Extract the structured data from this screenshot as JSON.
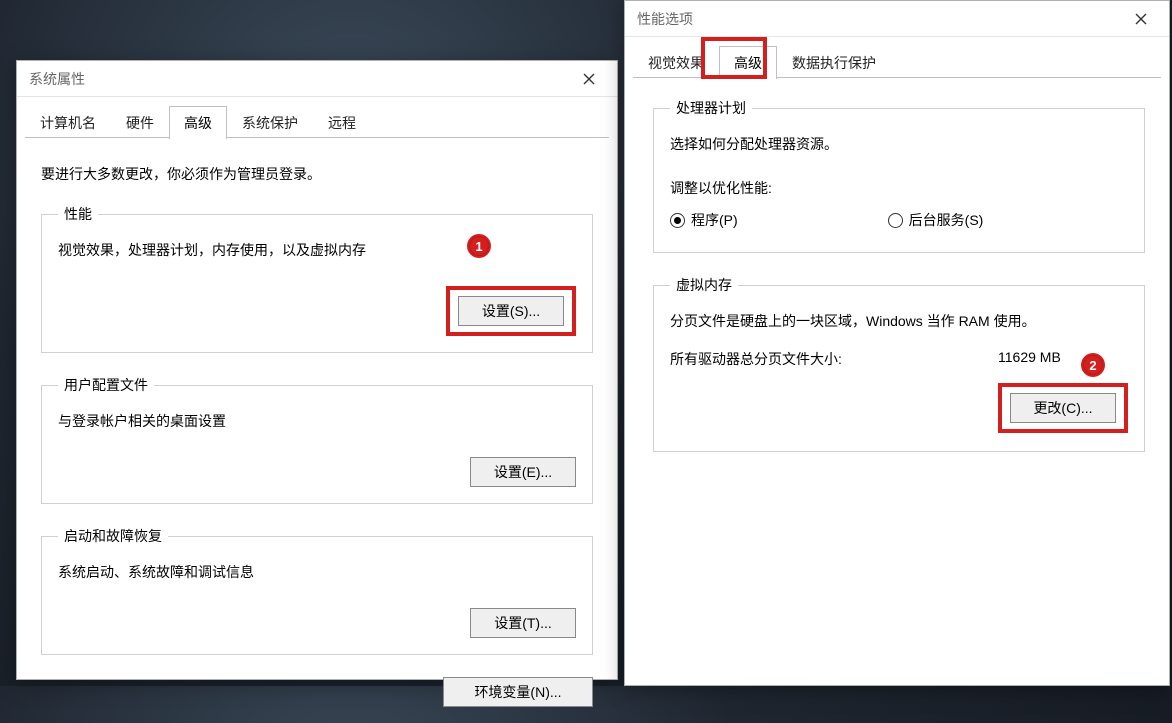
{
  "left": {
    "title": "系统属性",
    "tabs": [
      "计算机名",
      "硬件",
      "高级",
      "系统保护",
      "远程"
    ],
    "active_tab_index": 2,
    "instruction": "要进行大多数更改，你必须作为管理员登录。",
    "perf": {
      "legend": "性能",
      "desc": "视觉效果，处理器计划，内存使用，以及虚拟内存",
      "button": "设置(S)..."
    },
    "profiles": {
      "legend": "用户配置文件",
      "desc": "与登录帐户相关的桌面设置",
      "button": "设置(E)..."
    },
    "startup": {
      "legend": "启动和故障恢复",
      "desc": "系统启动、系统故障和调试信息",
      "button": "设置(T)..."
    },
    "env_button": "环境变量(N)...",
    "callout1": "1"
  },
  "right": {
    "title": "性能选项",
    "tabs": [
      "视觉效果",
      "高级",
      "数据执行保护"
    ],
    "active_tab_index": 1,
    "proc": {
      "legend": "处理器计划",
      "desc": "选择如何分配处理器资源。",
      "adjust_label": "调整以优化性能:",
      "radio_programs": "程序(P)",
      "radio_services": "后台服务(S)"
    },
    "vm": {
      "legend": "虚拟内存",
      "desc": "分页文件是硬盘上的一块区域，Windows 当作 RAM 使用。",
      "total_label": "所有驱动器总分页文件大小:",
      "total_value": "11629 MB",
      "button": "更改(C)..."
    },
    "callout2": "2"
  }
}
